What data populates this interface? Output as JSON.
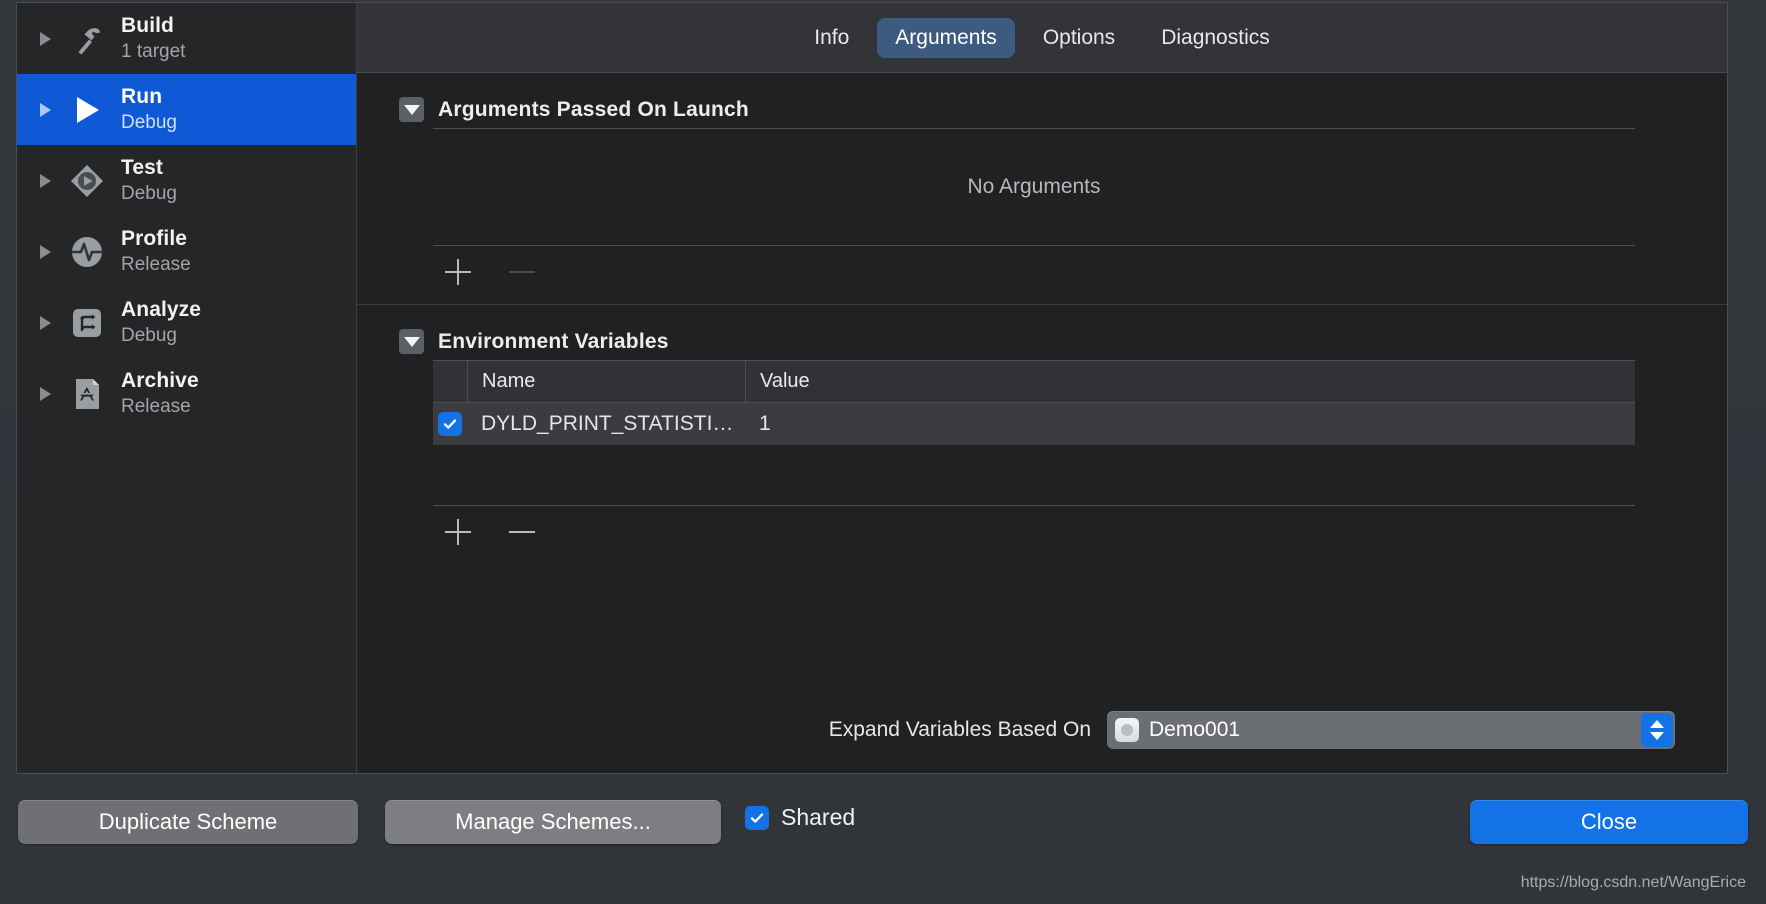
{
  "sidebar": {
    "items": [
      {
        "icon": "hammer-icon",
        "title": "Build",
        "subtitle": "1 target",
        "selected": false
      },
      {
        "icon": "play-icon",
        "title": "Run",
        "subtitle": "Debug",
        "selected": true
      },
      {
        "icon": "test-icon",
        "title": "Test",
        "subtitle": "Debug",
        "selected": false
      },
      {
        "icon": "profile-icon",
        "title": "Profile",
        "subtitle": "Release",
        "selected": false
      },
      {
        "icon": "analyze-icon",
        "title": "Analyze",
        "subtitle": "Debug",
        "selected": false
      },
      {
        "icon": "archive-icon",
        "title": "Archive",
        "subtitle": "Release",
        "selected": false
      }
    ]
  },
  "tabs": [
    {
      "label": "Info",
      "active": false
    },
    {
      "label": "Arguments",
      "active": true
    },
    {
      "label": "Options",
      "active": false
    },
    {
      "label": "Diagnostics",
      "active": false
    }
  ],
  "arguments_section": {
    "title": "Arguments Passed On Launch",
    "expanded": true,
    "empty_label": "No Arguments",
    "add_label": "+",
    "remove_label": "−",
    "remove_enabled": false
  },
  "environment_section": {
    "title": "Environment Variables",
    "expanded": true,
    "columns": [
      "Name",
      "Value"
    ],
    "rows": [
      {
        "checked": true,
        "name": "DYLD_PRINT_STATISTI…",
        "value": "1"
      }
    ],
    "add_label": "+",
    "remove_label": "−",
    "remove_enabled": true
  },
  "expand_variables": {
    "label": "Expand Variables Based On",
    "selected": "Demo001",
    "icon": "app-target-icon"
  },
  "footer": {
    "duplicate_label": "Duplicate Scheme",
    "manage_label": "Manage Schemes...",
    "shared_label": "Shared",
    "shared_checked": true,
    "close_label": "Close"
  },
  "watermark": "https://blog.csdn.net/WangErice",
  "colors": {
    "accent_blue": "#1373e6",
    "selected_row": "#1059d6",
    "active_tab": "#3d5b7e",
    "pane_bg": "#1f2123",
    "sidebar_bg": "#252628"
  }
}
